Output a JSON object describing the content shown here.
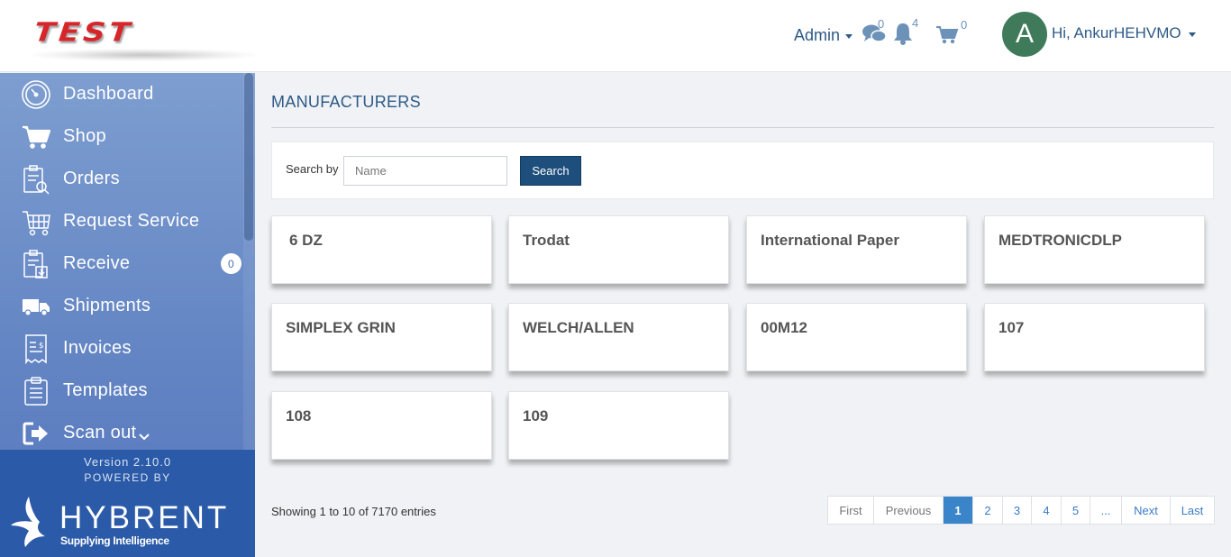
{
  "header": {
    "logo_text": "TEST",
    "role_menu": "Admin",
    "messages_count": "0",
    "notifications_count": "4",
    "cart_count": "0",
    "avatar_initial": "A",
    "greeting": "Hi, AnkurHEHVMO"
  },
  "sidebar": {
    "items": [
      {
        "label": "Dashboard",
        "icon": "dashboard-gauge-icon"
      },
      {
        "label": "Shop",
        "icon": "shopping-cart-icon"
      },
      {
        "label": "Orders",
        "icon": "clipboard-search-icon"
      },
      {
        "label": "Request Service",
        "icon": "service-cart-icon"
      },
      {
        "label": "Receive",
        "icon": "clipboard-receive-icon",
        "badge": "0"
      },
      {
        "label": "Shipments",
        "icon": "truck-icon"
      },
      {
        "label": "Invoices",
        "icon": "invoice-receipt-icon"
      },
      {
        "label": "Templates",
        "icon": "clipboard-list-icon"
      },
      {
        "label": "Scan out",
        "icon": "sign-out-icon"
      }
    ],
    "version": "Version 2.10.0",
    "powered_by": "POWERED BY",
    "brand_name": "HYBRENT",
    "brand_tagline": "Supplying Intelligence"
  },
  "main": {
    "title": "MANUFACTURERS",
    "search": {
      "label": "Search by",
      "placeholder": "Name",
      "value": "",
      "button": "Search"
    },
    "manufacturers": [
      "6 DZ",
      "Trodat",
      "International Paper",
      "MEDTRONICDLP",
      "SIMPLEX GRIN",
      "WELCH/ALLEN",
      "00M12",
      "107",
      "108",
      "109"
    ],
    "entries_text": "Showing 1 to 10 of 7170 entries",
    "pagination": [
      "First",
      "Previous",
      "1",
      "2",
      "3",
      "4",
      "5",
      "...",
      "Next",
      "Last"
    ],
    "active_page": "1"
  },
  "colors": {
    "accent": "#2d5a87",
    "sidebar": "#6a8cc8",
    "sidebar_footer": "#2b5ba8",
    "search_button": "#1e4e7c",
    "active_page": "#3a84c9",
    "avatar": "#3f7a5a",
    "logo": "#d6262b"
  }
}
